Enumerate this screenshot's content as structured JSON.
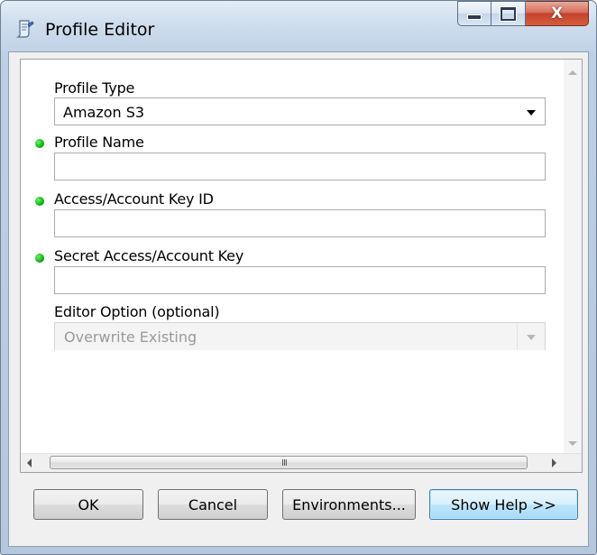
{
  "window": {
    "title": "Profile Editor",
    "close_glyph": "X"
  },
  "form": {
    "profile_type": {
      "label": "Profile Type",
      "value": "Amazon S3"
    },
    "profile_name": {
      "label": "Profile Name",
      "value": ""
    },
    "access_key_id": {
      "label": "Access/Account Key ID",
      "value": ""
    },
    "secret_key": {
      "label": "Secret Access/Account Key",
      "value": ""
    },
    "editor_option": {
      "label": "Editor Option (optional)",
      "value": "Overwrite Existing"
    }
  },
  "scrollbar": {
    "grip": "III"
  },
  "buttons": {
    "ok": "OK",
    "cancel": "Cancel",
    "environments": "Environments...",
    "show_help": "Show Help >>"
  },
  "colors": {
    "required_dot": "#10b010",
    "default_button_border": "#3c7fb1"
  }
}
